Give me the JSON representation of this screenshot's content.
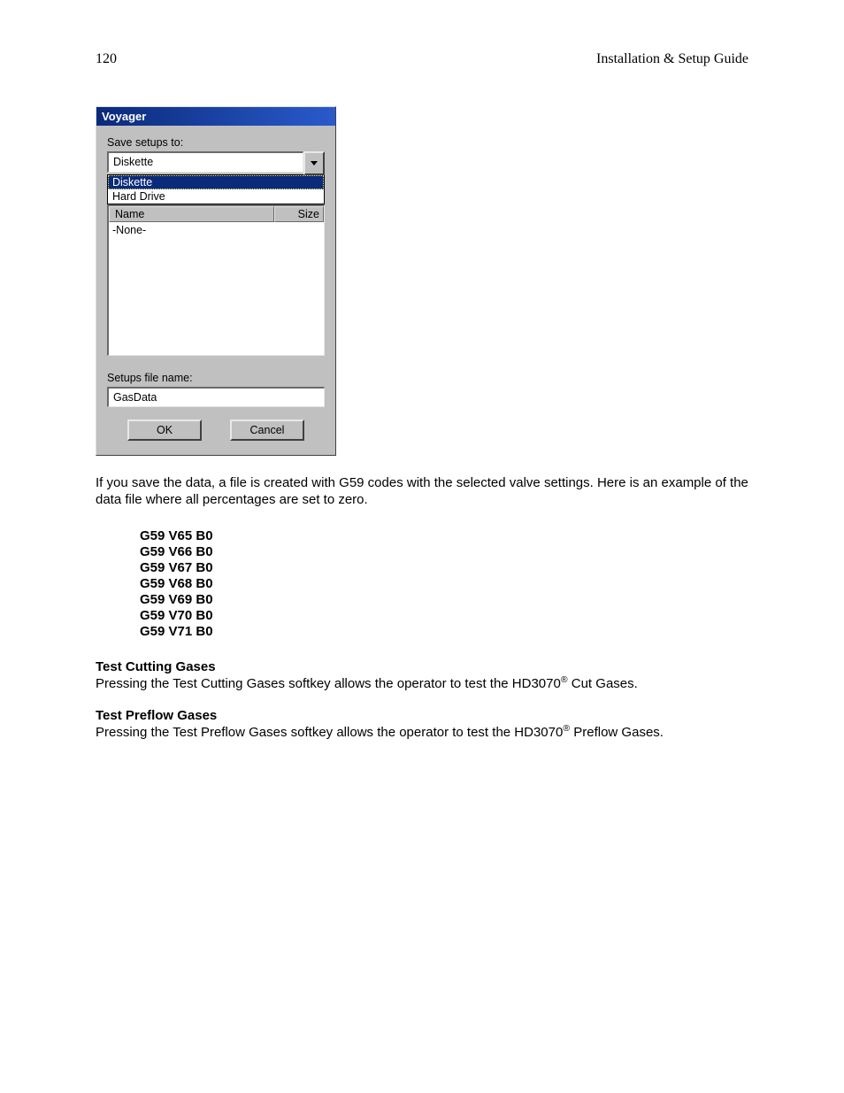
{
  "header": {
    "page_number": "120",
    "doc_title": "Installation & Setup Guide"
  },
  "dialog": {
    "title": "Voyager",
    "save_label": "Save setups to:",
    "combo_value": "Diskette",
    "options": [
      {
        "label": "Diskette",
        "selected": true
      },
      {
        "label": "Hard Drive",
        "selected": false
      }
    ],
    "columns": {
      "name": "Name",
      "size": "Size"
    },
    "list_empty": "-None-",
    "filename_label": "Setups file name:",
    "filename_value": "GasData",
    "ok": "OK",
    "cancel": "Cancel"
  },
  "paragraph1": "If you save the data,  a file is created with G59 codes with the selected valve settings.  Here is an example of the data file where all percentages are set to zero.",
  "gcodes": [
    "G59 V65 B0",
    "G59 V66 B0",
    "G59 V67 B0",
    "G59 V68 B0",
    "G59 V69 B0",
    "G59 V70 B0",
    "G59 V71 B0"
  ],
  "sections": {
    "cutting": {
      "title": "Test Cutting Gases",
      "body_pre": "Pressing the Test Cutting Gases softkey allows the operator to test the HD3070",
      "sup": "®",
      "body_post": " Cut Gases."
    },
    "preflow": {
      "title": "Test Preflow Gases",
      "body_pre": "Pressing the Test Preflow Gases softkey allows the operator to test the HD3070",
      "sup": "®",
      "body_post": " Preflow Gases."
    }
  }
}
